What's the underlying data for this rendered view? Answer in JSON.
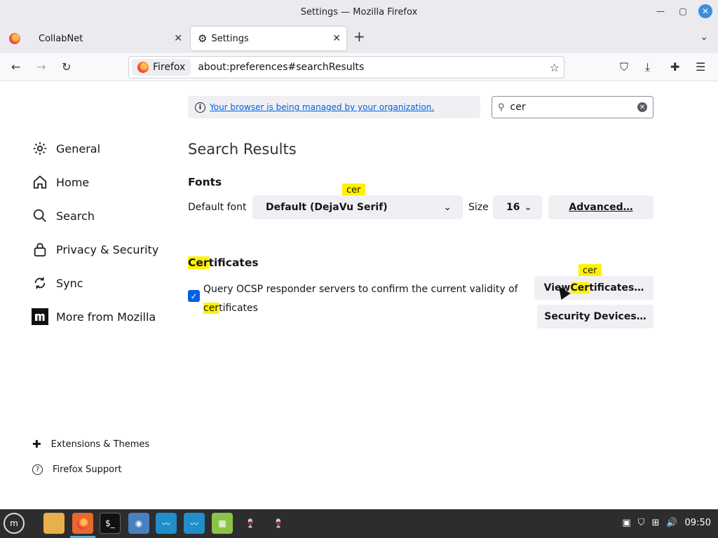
{
  "window": {
    "title": "Settings — Mozilla Firefox"
  },
  "tabs": [
    {
      "label": "CollabNet"
    },
    {
      "label": "Settings"
    }
  ],
  "urlbar": {
    "identity": "Firefox",
    "url": "about:preferences#searchResults"
  },
  "sidebar": {
    "items": [
      {
        "label": "General",
        "icon": "gear-icon"
      },
      {
        "label": "Home",
        "icon": "home-icon"
      },
      {
        "label": "Search",
        "icon": "search-icon"
      },
      {
        "label": "Privacy & Security",
        "icon": "lock-icon"
      },
      {
        "label": "Sync",
        "icon": "sync-icon"
      },
      {
        "label": "More from Mozilla",
        "icon": "mozilla-icon"
      }
    ],
    "footer": [
      {
        "label": "Extensions & Themes",
        "icon": "puzzle-icon"
      },
      {
        "label": "Firefox Support",
        "icon": "help-icon"
      }
    ]
  },
  "managed_notice": "Your browser is being managed by your organization.",
  "search": {
    "value": "cer"
  },
  "main": {
    "title": "Search Results",
    "fonts": {
      "heading": "Fonts",
      "default_font_label": "Default font",
      "default_font_value": "Default (DejaVu Serif)",
      "size_label": "Size",
      "size_value": "16",
      "advanced_button": "Advanced…",
      "tooltip": "cer"
    },
    "certificates": {
      "heading_hl": "Cer",
      "heading_rest": "tificates",
      "ocsp_line1": "Query OCSP responder servers to confirm the current validity of",
      "ocsp_line2_hl": "cer",
      "ocsp_line2_rest": "tificates",
      "ocsp_checked": true,
      "view_btn_pre": "View ",
      "view_btn_hl": "Cer",
      "view_btn_post": "tificates…",
      "security_devices_button": "Security Devices…",
      "tooltip": "cer"
    }
  },
  "taskbar": {
    "clock": "09:50"
  }
}
